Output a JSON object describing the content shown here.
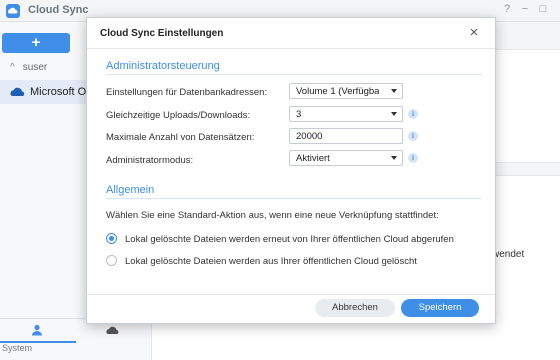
{
  "app": {
    "title": "Cloud Sync",
    "add_label": "+",
    "user_label": "suser",
    "connection_label": "Microsoft On",
    "system_label": "System",
    "win_help": "?",
    "win_min": "−",
    "win_max": "□",
    "bg_snippet": "wendet"
  },
  "dialog": {
    "title": "Cloud Sync Einstellungen",
    "close": "×",
    "admin_section": "Administratorsteuerung",
    "rows": [
      {
        "label": "Einstellungen für Datenbankadressen:",
        "value": "Volume 1 (Verfügba",
        "control": "dropdown",
        "info": false
      },
      {
        "label": "Gleichzeitige Uploads/Downloads:",
        "value": "3",
        "control": "dropdown",
        "info": true
      },
      {
        "label": "Maximale Anzahl von Datensätzen:",
        "value": "20000",
        "control": "text",
        "info": true
      },
      {
        "label": "Administratormodus:",
        "value": "Aktiviert",
        "control": "dropdown",
        "info": true
      }
    ],
    "info_glyph": "i",
    "general_section": "Allgemein",
    "description": "Wählen Sie eine Standard-Aktion aus, wenn eine neue Verknüpfung stattfindet:",
    "options": [
      {
        "label": "Lokal gelöschte Dateien werden erneut von Ihrer öffentlichen Cloud abgerufen",
        "checked": true
      },
      {
        "label": "Lokal gelöschte Dateien werden aus Ihrer öffentlichen Cloud gelöscht",
        "checked": false
      }
    ],
    "cancel_label": "Abbrechen",
    "save_label": "Speichern"
  },
  "colors": {
    "accent": "#3f8ee8",
    "sidebar_selected": "#e3ecf6"
  }
}
